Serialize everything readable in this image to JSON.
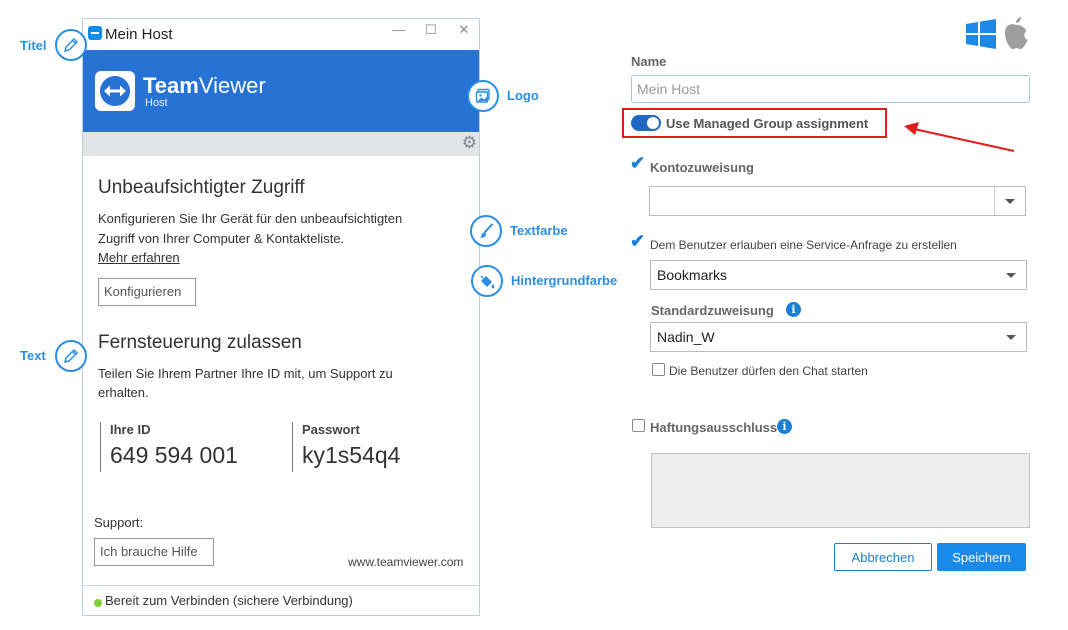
{
  "preview": {
    "window_title": "Mein Host",
    "brand_name_bold": "Team",
    "brand_name_regular": "Viewer",
    "brand_sub": "Host",
    "unattended_heading": "Unbeaufsichtigter Zugriff",
    "unattended_text_1": "Konfigurieren Sie Ihr Gerät für den unbeaufsichtigten",
    "unattended_text_2": "Zugriff von Ihrer Computer & Kontakteliste.",
    "learn_more": "Mehr erfahren",
    "configure_button": "Konfigurieren",
    "remote_heading": "Fernsteuerung zulassen",
    "remote_text_1": "Teilen Sie Ihrem Partner Ihre ID mit, um Support zu",
    "remote_text_2": "erhalten.",
    "id_label": "Ihre ID",
    "id_value": "649 594 001",
    "password_label": "Passwort",
    "password_value": "ky1s54q4",
    "support_label": "Support:",
    "help_button": "Ich brauche Hilfe",
    "website": "www.teamviewer.com",
    "status": "Bereit zum Verbinden (sichere Verbindung)",
    "status_color": "#7bd234"
  },
  "annotations": {
    "title": "Titel",
    "logo": "Logo",
    "textcolor": "Textfarbe",
    "bgcolor": "Hintergrundfarbe",
    "text": "Text"
  },
  "form": {
    "name_label": "Name",
    "name_placeholder": "Mein Host",
    "managed_group_label": "Use Managed Group assignment",
    "managed_group_on": true,
    "account_label": "Kontozuweisung",
    "account_checked": true,
    "account_value": "",
    "service_request_label": "Dem Benutzer erlauben eine Service-Anfrage zu erstellen",
    "service_request_checked": true,
    "service_group_value": "Bookmarks",
    "default_assignment_label": "Standardzuweisung",
    "default_assignment_value": "Nadin_W",
    "chat_label": "Die Benutzer dürfen den Chat starten",
    "chat_checked": false,
    "disclaimer_label": "Haftungsausschluss",
    "disclaimer_checked": false,
    "cancel_button": "Abbrechen",
    "save_button": "Speichern"
  },
  "colors": {
    "accent": "#1a8ae9",
    "banner": "#2672d5",
    "highlight": "#e21b1b"
  },
  "icons": [
    "windows-icon",
    "apple-icon",
    "pencil-icon",
    "image-icon",
    "brush-icon",
    "paint-bucket-icon",
    "gear-icon",
    "info-icon"
  ]
}
